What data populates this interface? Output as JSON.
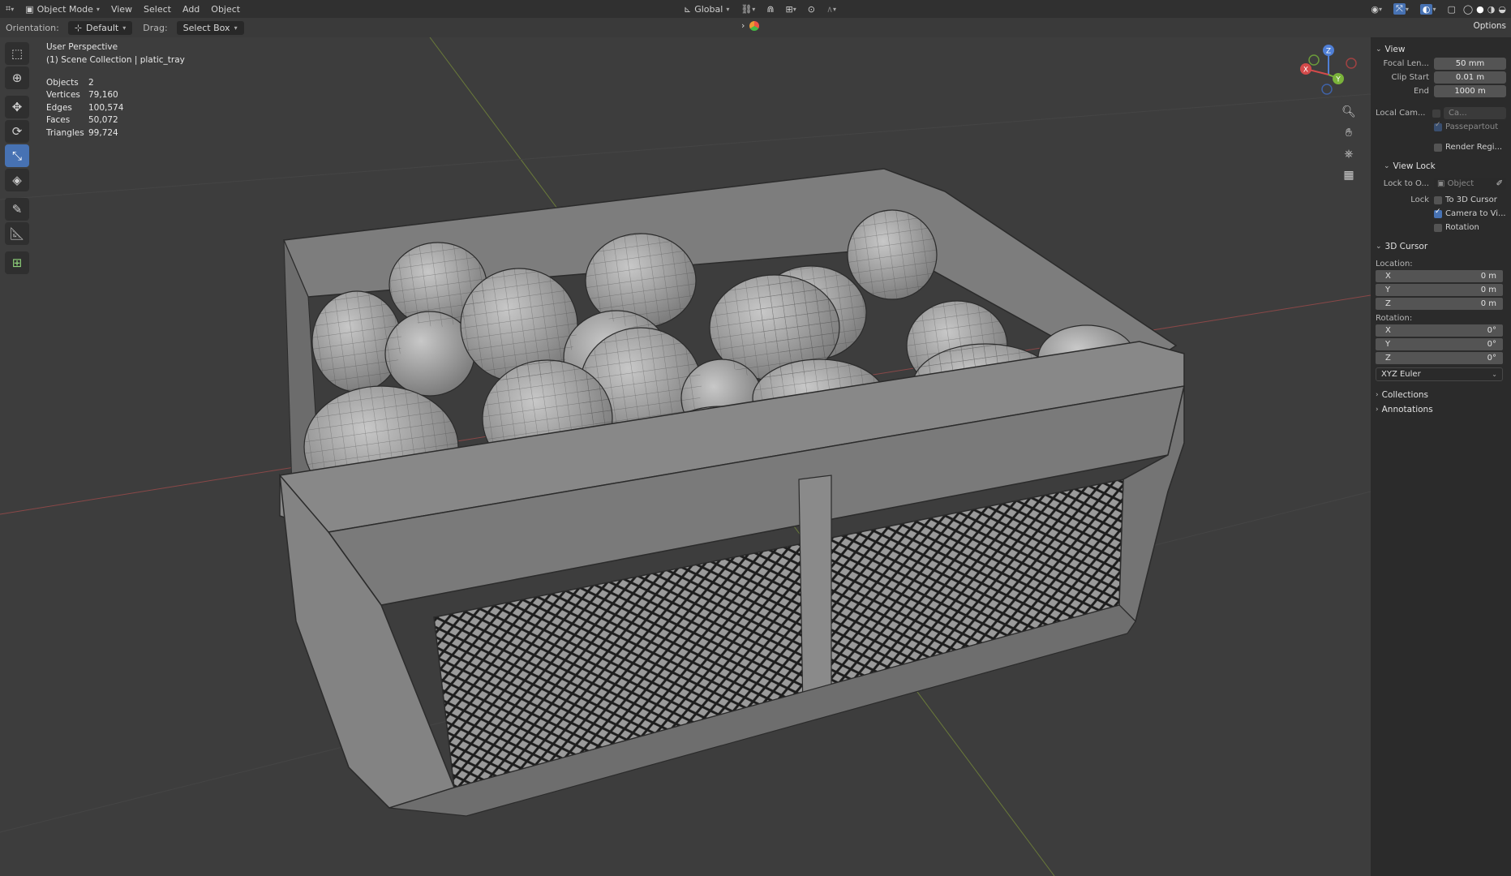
{
  "topbar": {
    "mode": "Object Mode",
    "menus": [
      "View",
      "Select",
      "Add",
      "Object"
    ],
    "transform_orientation": "Global"
  },
  "header": {
    "orientation_label": "Orientation:",
    "orientation_value": "Default",
    "drag_label": "Drag:",
    "drag_value": "Select Box",
    "options_label": "Options"
  },
  "overlay": {
    "perspective": "User Perspective",
    "collection": "(1) Scene Collection | platic_tray",
    "stats": [
      {
        "key": "Objects",
        "value": "2"
      },
      {
        "key": "Vertices",
        "value": "79,160"
      },
      {
        "key": "Edges",
        "value": "100,574"
      },
      {
        "key": "Faces",
        "value": "50,072"
      },
      {
        "key": "Triangles",
        "value": "99,724"
      }
    ]
  },
  "gizmo": {
    "x": "X",
    "y": "Y",
    "z": "Z"
  },
  "sidebar": {
    "view": {
      "title": "View",
      "focal_label": "Focal Len...",
      "focal_value": "50 mm",
      "clip_start_label": "Clip Start",
      "clip_start_value": "0.01 m",
      "end_label": "End",
      "end_value": "1000 m",
      "local_cam_label": "Local Cam...",
      "local_cam_value": "Ca...",
      "passepartout": "Passepartout",
      "render_region": "Render Regi..."
    },
    "view_lock": {
      "title": "View Lock",
      "lock_to_label": "Lock to O...",
      "lock_to_value": "Object",
      "lock_label": "Lock",
      "to_3d_cursor": "To 3D Cursor",
      "camera_to_view": "Camera to Vi...",
      "rotation": "Rotation"
    },
    "cursor": {
      "title": "3D Cursor",
      "location_label": "Location:",
      "loc": [
        {
          "axis": "X",
          "value": "0 m"
        },
        {
          "axis": "Y",
          "value": "0 m"
        },
        {
          "axis": "Z",
          "value": "0 m"
        }
      ],
      "rotation_label": "Rotation:",
      "rot": [
        {
          "axis": "X",
          "value": "0°"
        },
        {
          "axis": "Y",
          "value": "0°"
        },
        {
          "axis": "Z",
          "value": "0°"
        }
      ],
      "rotation_mode": "XYZ Euler"
    },
    "collections": "Collections",
    "annotations": "Annotations"
  }
}
